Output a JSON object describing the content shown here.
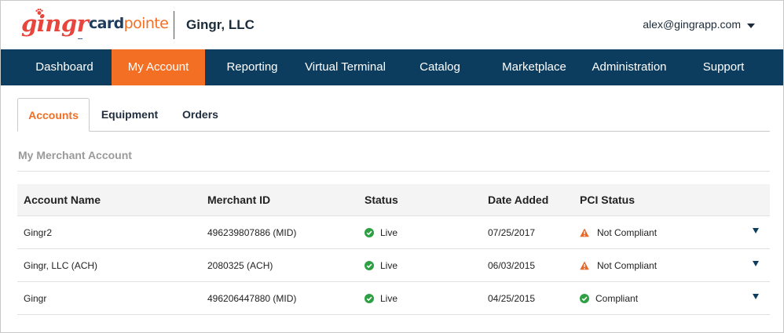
{
  "header": {
    "logo_gingr": "gingr",
    "logo_card": "card",
    "logo_pointe": "pointe",
    "company": "Gingr, LLC",
    "user_email": "alex@gingrapp.com"
  },
  "colors": {
    "brand_orange": "#f26f24",
    "nav_blue": "#0d3d5e",
    "gingr_red": "#e8453c",
    "success_green": "#2ea043",
    "warning_orange": "#e8692a"
  },
  "nav": [
    {
      "label": "Dashboard"
    },
    {
      "label": "My Account",
      "active": true
    },
    {
      "label": "Reporting"
    },
    {
      "label": "Virtual Terminal"
    },
    {
      "label": "Catalog"
    },
    {
      "label": "Marketplace"
    },
    {
      "label": "Administration"
    },
    {
      "label": "Support"
    }
  ],
  "tabs": [
    {
      "label": "Accounts",
      "active": true
    },
    {
      "label": "Equipment"
    },
    {
      "label": "Orders"
    }
  ],
  "section_title": "My Merchant Account",
  "table": {
    "columns": [
      "Account Name",
      "Merchant ID",
      "Status",
      "Date Added",
      "PCI Status"
    ],
    "rows": [
      {
        "name": "Gingr2",
        "mid": "496239807886 (MID)",
        "status": "Live",
        "date": "07/25/2017",
        "pci": "Not Compliant",
        "pci_icon": "warning-icon"
      },
      {
        "name": "Gingr, LLC (ACH)",
        "mid": "2080325 (ACH)",
        "status": "Live",
        "date": "06/03/2015",
        "pci": "Not Compliant",
        "pci_icon": "warning-icon"
      },
      {
        "name": "Gingr",
        "mid": "496206447880 (MID)",
        "status": "Live",
        "date": "04/25/2015",
        "pci": "Compliant",
        "pci_icon": "check-circle-icon"
      }
    ]
  }
}
